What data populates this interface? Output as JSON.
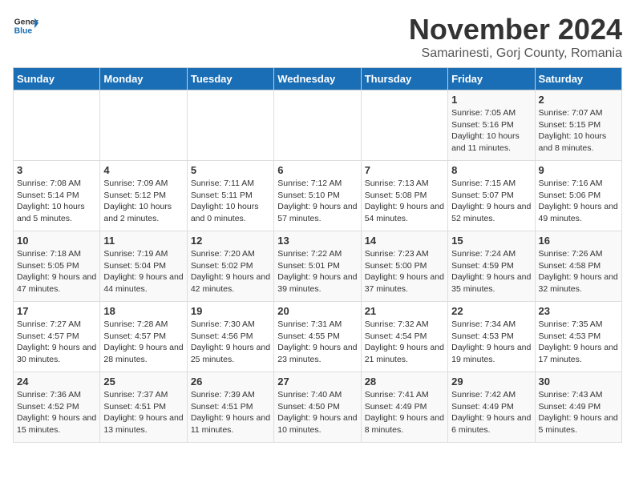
{
  "logo": {
    "general": "General",
    "blue": "Blue"
  },
  "header": {
    "month": "November 2024",
    "location": "Samarinesti, Gorj County, Romania"
  },
  "days_of_week": [
    "Sunday",
    "Monday",
    "Tuesday",
    "Wednesday",
    "Thursday",
    "Friday",
    "Saturday"
  ],
  "weeks": [
    [
      {
        "day": "",
        "info": ""
      },
      {
        "day": "",
        "info": ""
      },
      {
        "day": "",
        "info": ""
      },
      {
        "day": "",
        "info": ""
      },
      {
        "day": "",
        "info": ""
      },
      {
        "day": "1",
        "info": "Sunrise: 7:05 AM\nSunset: 5:16 PM\nDaylight: 10 hours and 11 minutes."
      },
      {
        "day": "2",
        "info": "Sunrise: 7:07 AM\nSunset: 5:15 PM\nDaylight: 10 hours and 8 minutes."
      }
    ],
    [
      {
        "day": "3",
        "info": "Sunrise: 7:08 AM\nSunset: 5:14 PM\nDaylight: 10 hours and 5 minutes."
      },
      {
        "day": "4",
        "info": "Sunrise: 7:09 AM\nSunset: 5:12 PM\nDaylight: 10 hours and 2 minutes."
      },
      {
        "day": "5",
        "info": "Sunrise: 7:11 AM\nSunset: 5:11 PM\nDaylight: 10 hours and 0 minutes."
      },
      {
        "day": "6",
        "info": "Sunrise: 7:12 AM\nSunset: 5:10 PM\nDaylight: 9 hours and 57 minutes."
      },
      {
        "day": "7",
        "info": "Sunrise: 7:13 AM\nSunset: 5:08 PM\nDaylight: 9 hours and 54 minutes."
      },
      {
        "day": "8",
        "info": "Sunrise: 7:15 AM\nSunset: 5:07 PM\nDaylight: 9 hours and 52 minutes."
      },
      {
        "day": "9",
        "info": "Sunrise: 7:16 AM\nSunset: 5:06 PM\nDaylight: 9 hours and 49 minutes."
      }
    ],
    [
      {
        "day": "10",
        "info": "Sunrise: 7:18 AM\nSunset: 5:05 PM\nDaylight: 9 hours and 47 minutes."
      },
      {
        "day": "11",
        "info": "Sunrise: 7:19 AM\nSunset: 5:04 PM\nDaylight: 9 hours and 44 minutes."
      },
      {
        "day": "12",
        "info": "Sunrise: 7:20 AM\nSunset: 5:02 PM\nDaylight: 9 hours and 42 minutes."
      },
      {
        "day": "13",
        "info": "Sunrise: 7:22 AM\nSunset: 5:01 PM\nDaylight: 9 hours and 39 minutes."
      },
      {
        "day": "14",
        "info": "Sunrise: 7:23 AM\nSunset: 5:00 PM\nDaylight: 9 hours and 37 minutes."
      },
      {
        "day": "15",
        "info": "Sunrise: 7:24 AM\nSunset: 4:59 PM\nDaylight: 9 hours and 35 minutes."
      },
      {
        "day": "16",
        "info": "Sunrise: 7:26 AM\nSunset: 4:58 PM\nDaylight: 9 hours and 32 minutes."
      }
    ],
    [
      {
        "day": "17",
        "info": "Sunrise: 7:27 AM\nSunset: 4:57 PM\nDaylight: 9 hours and 30 minutes."
      },
      {
        "day": "18",
        "info": "Sunrise: 7:28 AM\nSunset: 4:57 PM\nDaylight: 9 hours and 28 minutes."
      },
      {
        "day": "19",
        "info": "Sunrise: 7:30 AM\nSunset: 4:56 PM\nDaylight: 9 hours and 25 minutes."
      },
      {
        "day": "20",
        "info": "Sunrise: 7:31 AM\nSunset: 4:55 PM\nDaylight: 9 hours and 23 minutes."
      },
      {
        "day": "21",
        "info": "Sunrise: 7:32 AM\nSunset: 4:54 PM\nDaylight: 9 hours and 21 minutes."
      },
      {
        "day": "22",
        "info": "Sunrise: 7:34 AM\nSunset: 4:53 PM\nDaylight: 9 hours and 19 minutes."
      },
      {
        "day": "23",
        "info": "Sunrise: 7:35 AM\nSunset: 4:53 PM\nDaylight: 9 hours and 17 minutes."
      }
    ],
    [
      {
        "day": "24",
        "info": "Sunrise: 7:36 AM\nSunset: 4:52 PM\nDaylight: 9 hours and 15 minutes."
      },
      {
        "day": "25",
        "info": "Sunrise: 7:37 AM\nSunset: 4:51 PM\nDaylight: 9 hours and 13 minutes."
      },
      {
        "day": "26",
        "info": "Sunrise: 7:39 AM\nSunset: 4:51 PM\nDaylight: 9 hours and 11 minutes."
      },
      {
        "day": "27",
        "info": "Sunrise: 7:40 AM\nSunset: 4:50 PM\nDaylight: 9 hours and 10 minutes."
      },
      {
        "day": "28",
        "info": "Sunrise: 7:41 AM\nSunset: 4:49 PM\nDaylight: 9 hours and 8 minutes."
      },
      {
        "day": "29",
        "info": "Sunrise: 7:42 AM\nSunset: 4:49 PM\nDaylight: 9 hours and 6 minutes."
      },
      {
        "day": "30",
        "info": "Sunrise: 7:43 AM\nSunset: 4:49 PM\nDaylight: 9 hours and 5 minutes."
      }
    ]
  ]
}
